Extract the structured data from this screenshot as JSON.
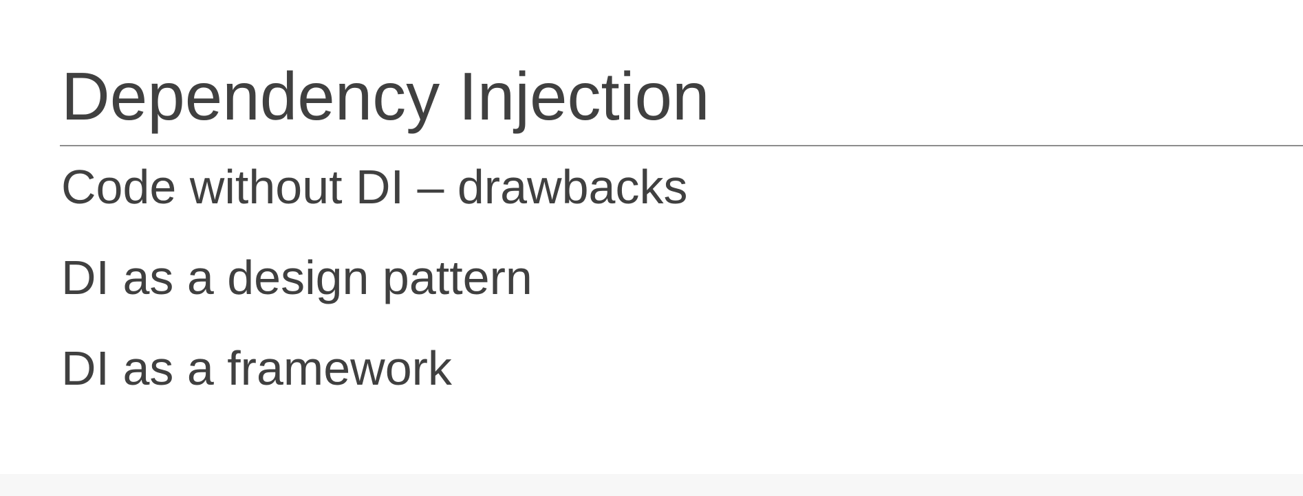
{
  "slide": {
    "title": "Dependency Injection",
    "bullets": [
      "Code without DI – drawbacks",
      "DI as a design pattern",
      "DI as a framework"
    ]
  }
}
